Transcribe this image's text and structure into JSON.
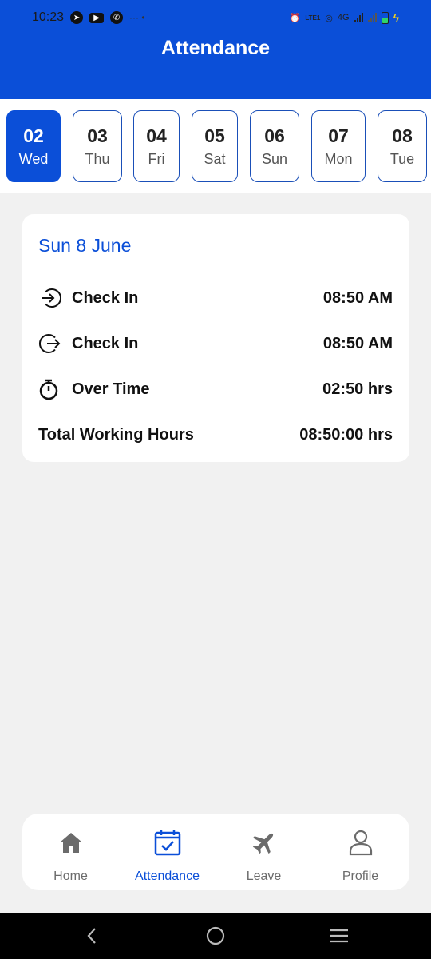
{
  "status_bar": {
    "time": "10:23",
    "network": "4G",
    "volte": "LTE1"
  },
  "header": {
    "title": "Attendance"
  },
  "dates": [
    {
      "num": "02",
      "day": "Wed",
      "active": true
    },
    {
      "num": "03",
      "day": "Thu",
      "active": false
    },
    {
      "num": "04",
      "day": "Fri",
      "active": false
    },
    {
      "num": "05",
      "day": "Sat",
      "active": false
    },
    {
      "num": "06",
      "day": "Sun",
      "active": false
    },
    {
      "num": "07",
      "day": "Mon",
      "active": false
    },
    {
      "num": "08",
      "day": "Tue",
      "active": false
    }
  ],
  "card": {
    "date_title": "Sun 8 June",
    "rows": [
      {
        "icon": "check-in-icon",
        "label": "Check In",
        "value": "08:50 AM"
      },
      {
        "icon": "check-out-icon",
        "label": "Check In",
        "value": "08:50 AM"
      },
      {
        "icon": "stopwatch-icon",
        "label": "Over Time",
        "value": "02:50 hrs"
      },
      {
        "icon": "",
        "label": "Total Working Hours",
        "value": "08:50:00 hrs"
      }
    ]
  },
  "bottom_nav": [
    {
      "icon": "home-icon",
      "label": "Home",
      "active": false
    },
    {
      "icon": "calendar-check-icon",
      "label": "Attendance",
      "active": true
    },
    {
      "icon": "airplane-icon",
      "label": "Leave",
      "active": false
    },
    {
      "icon": "user-icon",
      "label": "Profile",
      "active": false
    }
  ],
  "colors": {
    "primary": "#0b4fd8",
    "background": "#f1f1f1",
    "nav_inactive": "#6b6b6b"
  }
}
